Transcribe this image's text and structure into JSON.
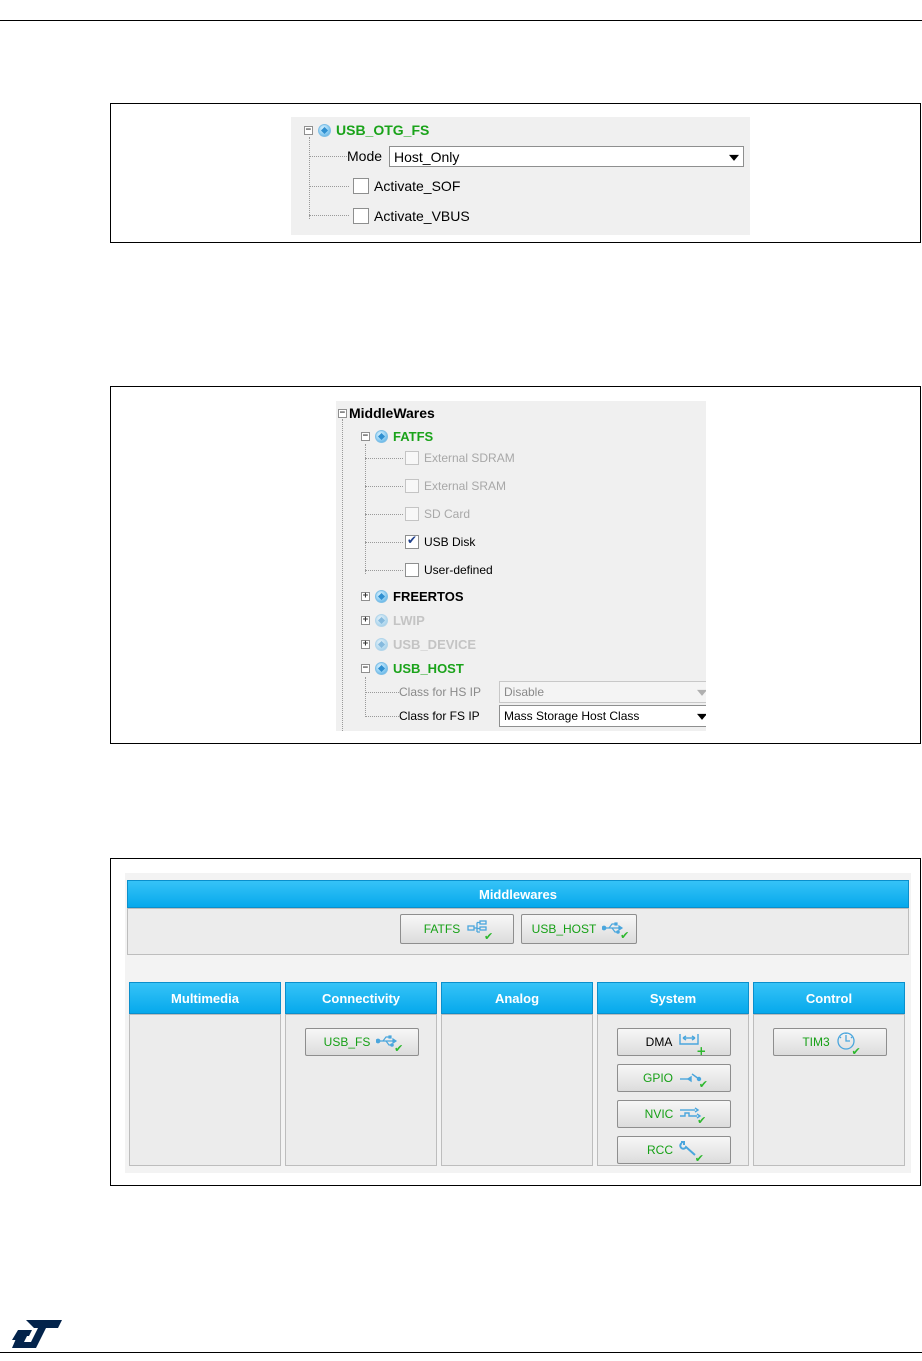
{
  "otg_panel": {
    "title": "USB_OTG_FS",
    "mode_label": "Mode",
    "mode_value": "Host_Only",
    "checkboxes": [
      {
        "label": "Activate_SOF",
        "checked": false
      },
      {
        "label": "Activate_VBUS",
        "checked": false
      }
    ]
  },
  "middlewares_panel": {
    "root_label": "MiddleWares",
    "fatfs_label": "FATFS",
    "fatfs_options": [
      {
        "label": "External SDRAM",
        "checked": false,
        "enabled": false
      },
      {
        "label": "External SRAM",
        "checked": false,
        "enabled": false
      },
      {
        "label": "SD Card",
        "checked": false,
        "enabled": false
      },
      {
        "label": "USB Disk",
        "checked": true,
        "enabled": true
      },
      {
        "label": "User-defined",
        "checked": false,
        "enabled": true
      }
    ],
    "freertos_label": "FREERTOS",
    "lwip_label": "LWIP",
    "usb_device_label": "USB_DEVICE",
    "usb_host_label": "USB_HOST",
    "hs_label": "Class for HS IP",
    "hs_value": "Disable",
    "fs_label": "Class for FS IP",
    "fs_value": "Mass Storage Host Class"
  },
  "config_panel": {
    "middlewares_header": "Middlewares",
    "middleware_buttons": [
      "FATFS",
      "USB_HOST"
    ],
    "categories": [
      "Multimedia",
      "Connectivity",
      "Analog",
      "System",
      "Control"
    ],
    "connectivity_buttons": [
      "USB_FS"
    ],
    "system_buttons": [
      "DMA",
      "GPIO",
      "NVIC",
      "RCC"
    ],
    "control_buttons": [
      "TIM3"
    ]
  },
  "colors": {
    "header_blue": "#06a9ec",
    "ok_green": "#1aa31a",
    "disabled_gray": "#a8a8a8",
    "logo_blue": "#03234b"
  },
  "logo_icon": "st-logo"
}
